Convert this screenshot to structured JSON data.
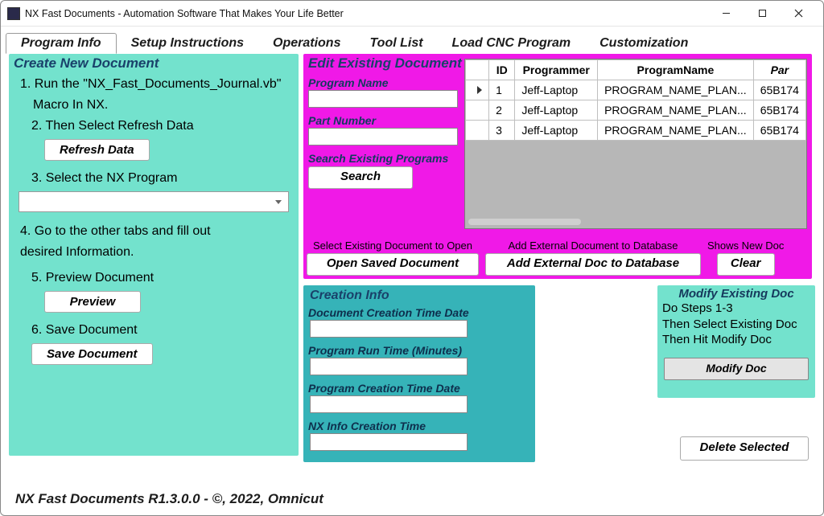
{
  "window": {
    "title": "NX Fast Documents  - Automation Software That Makes Your Life Better"
  },
  "tabs": [
    "Program Info",
    "Setup Instructions",
    "Operations",
    "Tool List",
    "Load CNC Program",
    "Customization"
  ],
  "active_tab_index": 0,
  "left_panel": {
    "title": "Create New Document",
    "step1a": "1. Run the \"NX_Fast_Documents_Journal.vb\"",
    "step1b": "Macro In NX.",
    "step2": "2. Then Select Refresh Data",
    "refresh_btn": "Refresh Data",
    "step3": "3. Select the NX Program",
    "select_value": "",
    "step4a": "4. Go to the other tabs and fill out",
    "step4b": "desired Information.",
    "step5": "5. Preview Document",
    "preview_btn": "Preview",
    "step6": "6. Save Document",
    "save_btn": "Save Document"
  },
  "edit_panel": {
    "title": "Edit Existing Document",
    "program_name_label": "Program Name",
    "program_name_value": "",
    "part_number_label": "Part Number",
    "part_number_value": "",
    "search_label": "Search Existing Programs",
    "search_btn": "Search",
    "open_caption": "Select Existing Document to Open",
    "open_btn": "Open Saved Document",
    "add_caption": "Add External Document to Database",
    "add_btn": "Add External Doc to Database",
    "clear_caption": "Shows New Doc",
    "clear_btn": "Clear"
  },
  "grid": {
    "headers": [
      "ID",
      "Programmer",
      "ProgramName",
      "Par"
    ],
    "rows": [
      {
        "id": "1",
        "programmer": "Jeff-Laptop",
        "name": "PROGRAM_NAME_PLAN...",
        "par": "65B174"
      },
      {
        "id": "2",
        "programmer": "Jeff-Laptop",
        "name": "PROGRAM_NAME_PLAN...",
        "par": "65B174"
      },
      {
        "id": "3",
        "programmer": "Jeff-Laptop",
        "name": "PROGRAM_NAME_PLAN...",
        "par": "65B174"
      }
    ]
  },
  "creation_panel": {
    "title": "Creation Info",
    "doc_time_label": "Document Creation Time Date",
    "doc_time_value": "",
    "run_time_label": "Program Run Time (Minutes)",
    "run_time_value": "",
    "prog_time_label": "Program Creation Time Date",
    "prog_time_value": "",
    "nx_time_label": "NX Info Creation Time",
    "nx_time_value": ""
  },
  "modify_panel": {
    "title": "Modify Existing Doc",
    "line1": "Do Steps 1-3",
    "line2": "Then Select Existing Doc",
    "line3": "Then Hit Modify Doc",
    "btn": "Modify Doc"
  },
  "delete_btn": "Delete Selected",
  "footer": "NX Fast Documents R1.3.0.0 - ©, 2022, Omnicut"
}
